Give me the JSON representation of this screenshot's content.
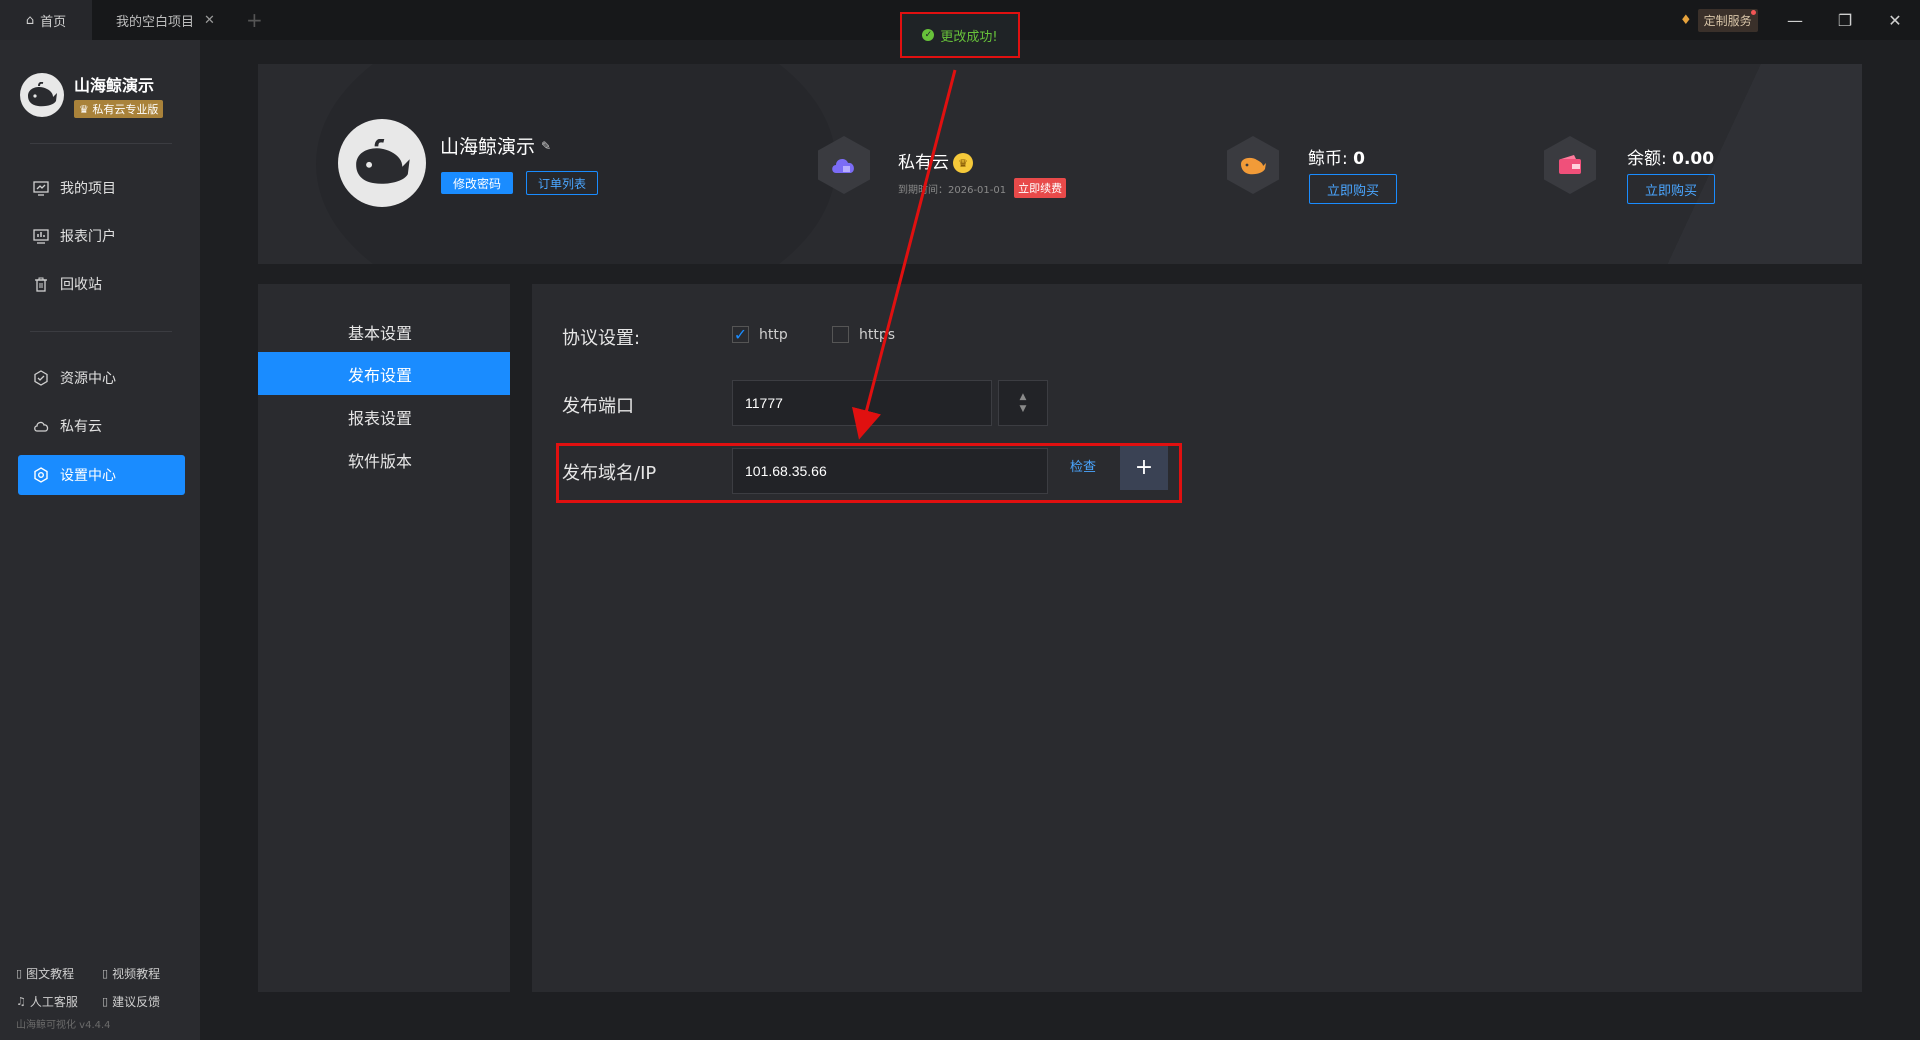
{
  "titlebar": {
    "home_tab": "首页",
    "project_tab": "我的空白项目",
    "close_glyph": "✕",
    "add_glyph": "+",
    "custom_service": "定制服务",
    "window_controls": [
      "—",
      "❐",
      "✕"
    ]
  },
  "toast": {
    "message": "更改成功!",
    "color": "#67c23a"
  },
  "sidebar": {
    "brand_name": "山海鲸演示",
    "edition": "♛ 私有云专业版",
    "nav": [
      {
        "label": "我的项目",
        "icon": "monitor-chart-icon"
      },
      {
        "label": "报表门户",
        "icon": "report-icon"
      },
      {
        "label": "回收站",
        "icon": "trash-icon"
      },
      {
        "label": "资源中心",
        "icon": "hexagon-icon"
      },
      {
        "label": "私有云",
        "icon": "cloud-icon"
      },
      {
        "label": "设置中心",
        "icon": "gear-icon",
        "active": true
      }
    ],
    "help": [
      "图文教程",
      "视频教程",
      "人工客服",
      "建议反馈"
    ],
    "version": "山海鲸可视化 v4.4.4"
  },
  "profile": {
    "name": "山海鲸演示",
    "change_password": "修改密码",
    "order_list": "订单列表",
    "private_cloud": {
      "title": "私有云",
      "expiry_label": "到期时间：2026-01-01",
      "renew": "立即续费"
    },
    "coins": {
      "label": "鲸币:",
      "value": "0",
      "buy": "立即购买"
    },
    "balance": {
      "label": "余额:",
      "value": "0.00",
      "buy": "立即购买"
    }
  },
  "settings_nav": [
    "基本设置",
    "发布设置",
    "报表设置",
    "软件版本"
  ],
  "publish": {
    "protocol_label": "协议设置:",
    "protocol_options": [
      {
        "label": "http",
        "checked": true
      },
      {
        "label": "https",
        "checked": false
      }
    ],
    "port_label": "发布端口",
    "port_value": "11777",
    "domain_label": "发布域名/IP",
    "domain_value": "101.68.35.66",
    "check": "检查",
    "add": "+"
  },
  "colors": {
    "accent": "#1a8cff",
    "annotation": "#e01010",
    "renew": "#e84a4a"
  }
}
